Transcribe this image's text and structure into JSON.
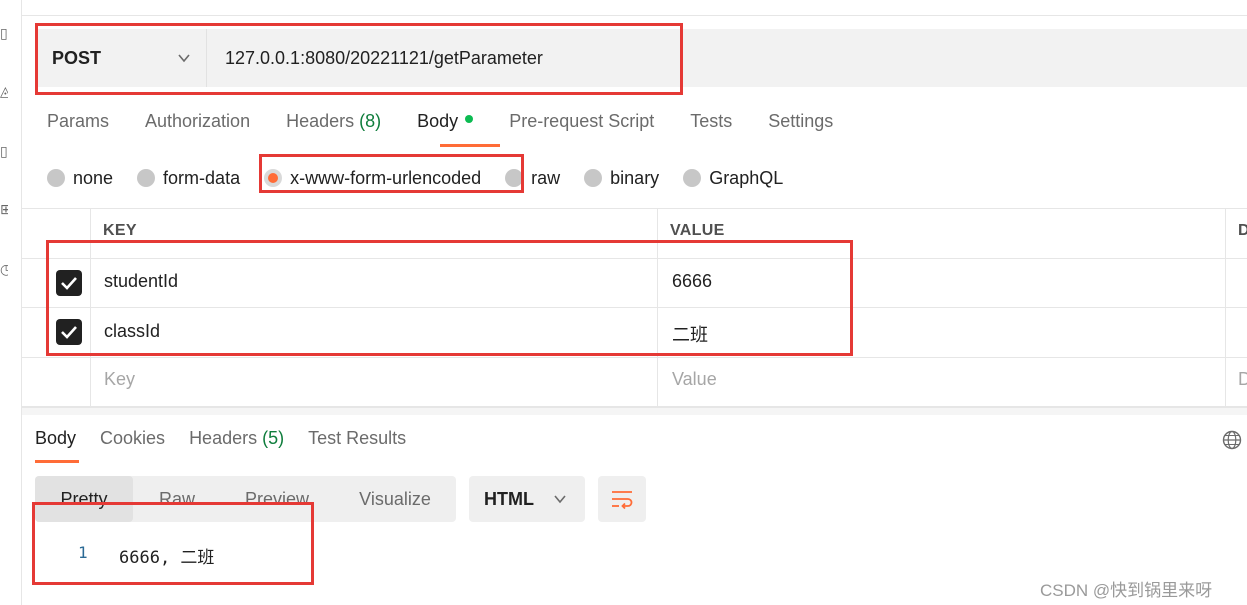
{
  "request": {
    "method": "POST",
    "url": "127.0.0.1:8080/20221121/getParameter"
  },
  "request_tabs": [
    {
      "label": "Params",
      "count": ""
    },
    {
      "label": "Authorization",
      "count": ""
    },
    {
      "label": "Headers",
      "count": "(8)"
    },
    {
      "label": "Body",
      "count": ""
    },
    {
      "label": "Pre-request Script",
      "count": ""
    },
    {
      "label": "Tests",
      "count": ""
    },
    {
      "label": "Settings",
      "count": ""
    }
  ],
  "active_request_tab": "Body",
  "body_types": [
    "none",
    "form-data",
    "x-www-form-urlencoded",
    "raw",
    "binary",
    "GraphQL"
  ],
  "selected_body_type": "x-www-form-urlencoded",
  "params_table": {
    "headers": {
      "key": "KEY",
      "value": "VALUE",
      "desc": "D"
    },
    "rows": [
      {
        "checked": true,
        "key": "studentId",
        "value": "6666"
      },
      {
        "checked": true,
        "key": "classId",
        "value": "二班"
      }
    ],
    "placeholder": {
      "key": "Key",
      "value": "Value",
      "desc": "D"
    }
  },
  "response_tabs": [
    {
      "label": "Body",
      "count": ""
    },
    {
      "label": "Cookies",
      "count": ""
    },
    {
      "label": "Headers",
      "count": "(5)"
    },
    {
      "label": "Test Results",
      "count": ""
    }
  ],
  "view_modes": [
    "Pretty",
    "Raw",
    "Preview",
    "Visualize"
  ],
  "active_view_mode": "Pretty",
  "format": "HTML",
  "response_body": {
    "line_number": "1",
    "text": "6666, 二班"
  },
  "watermark": "CSDN @快到锅里来呀",
  "colors": {
    "accent": "#ff6c37",
    "annotation_red": "#e53935",
    "success_green": "#0cbb52"
  },
  "icons": {
    "method_dropdown": "chevron-down-icon",
    "format_dropdown": "chevron-down-icon",
    "wrap": "wrap-lines-icon",
    "globe": "globe-icon",
    "checkbox": "checkmark-icon"
  }
}
